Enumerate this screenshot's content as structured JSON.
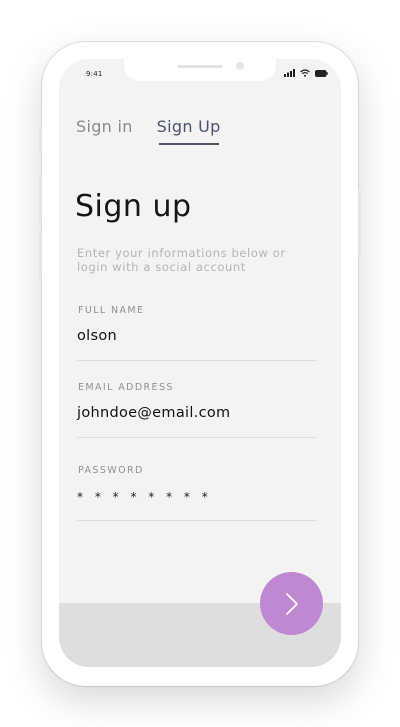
{
  "status_bar": {
    "time": "9:41"
  },
  "tabs": [
    {
      "label": "Sign in",
      "active": false
    },
    {
      "label": "Sign Up",
      "active": true
    }
  ],
  "page": {
    "title": "Sign up",
    "subtitle": "Enter your informations below or login with a social account"
  },
  "form": {
    "full_name": {
      "label": "FULL NAME",
      "value": "olson"
    },
    "email": {
      "label": "EMAIL ADDRESS",
      "value": "johndoe@email.com"
    },
    "password": {
      "label": "PASSWORD",
      "value": "* * * * * * * *"
    }
  },
  "next_button": {
    "icon": "chevron-right-icon",
    "color": "#c088d0"
  },
  "colors": {
    "accent": "#4a5270",
    "button": "#c088d0",
    "screen_bg": "#f3f3f3"
  }
}
